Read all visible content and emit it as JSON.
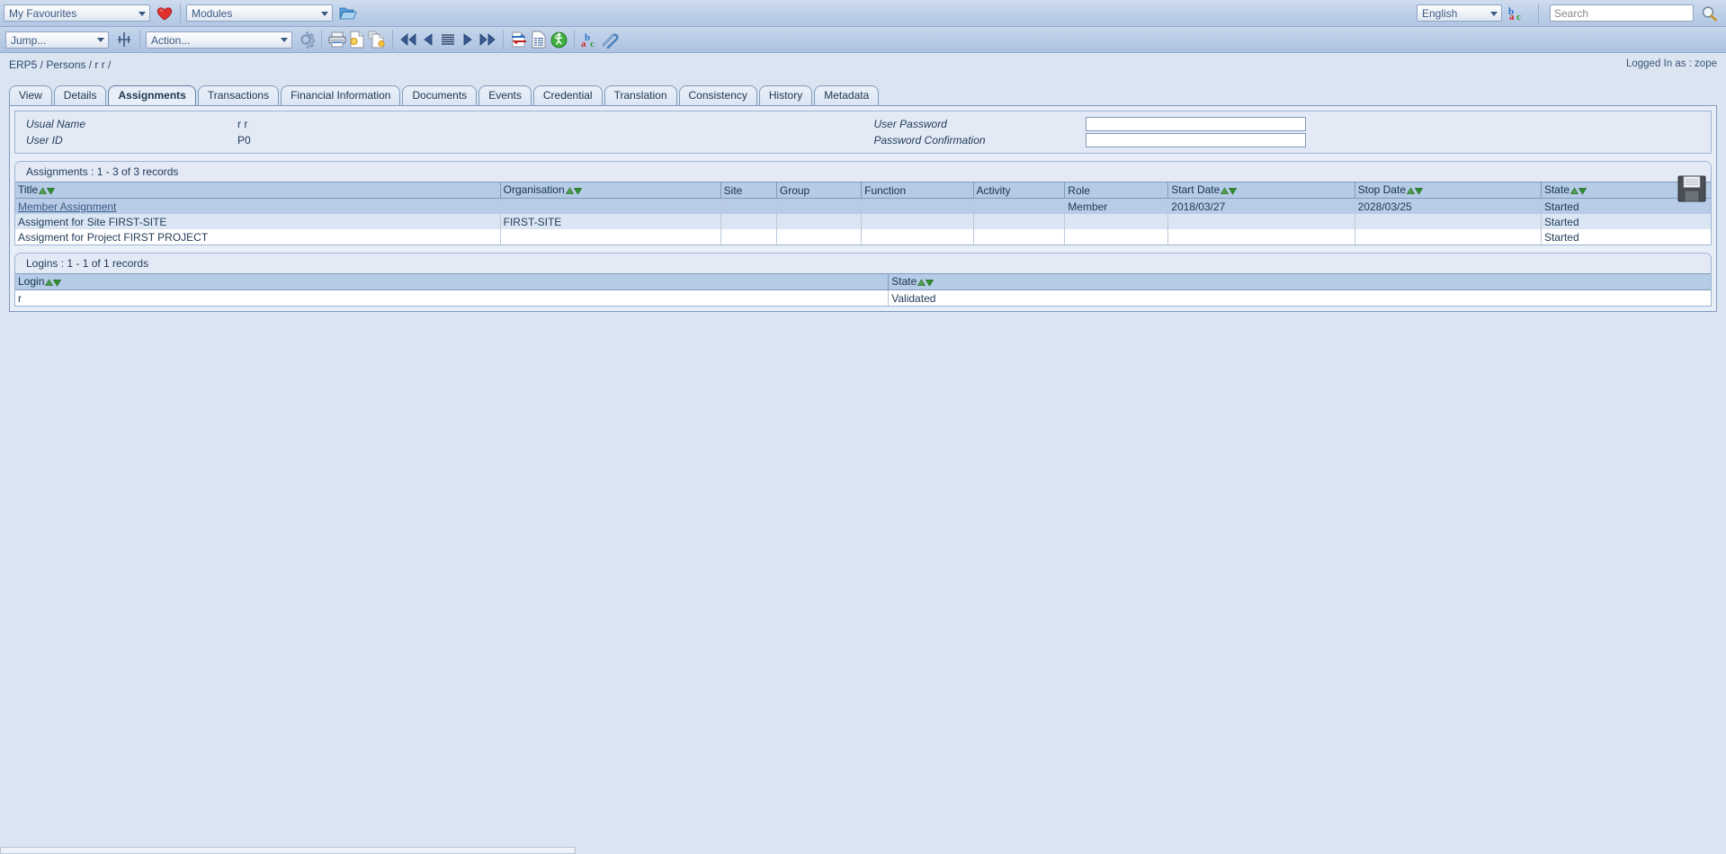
{
  "topbar": {
    "favourites_label": "My Favourites",
    "modules_label": "Modules",
    "language_label": "English",
    "search_placeholder": "Search",
    "search_value": "",
    "icons": [
      "heart-icon",
      "open-folder-icon",
      "translate-icon",
      "search-icon"
    ]
  },
  "actionbar": {
    "jump_label": "Jump...",
    "action_label": "Action...",
    "icons": [
      "jump-target-icon",
      "gear-icon",
      "print-icon",
      "new-document-icon",
      "copy-document-icon",
      "first-page-icon",
      "previous-page-icon",
      "list-icon",
      "next-page-icon",
      "last-page-icon",
      "exchange-icon",
      "report-icon",
      "run-icon",
      "translate-icon",
      "clip-icon"
    ]
  },
  "breadcrumb": "ERP5 / Persons / r r /",
  "logged_in": "Logged In as : zope",
  "tabs": [
    {
      "label": "View",
      "active": false
    },
    {
      "label": "Details",
      "active": false
    },
    {
      "label": "Assignments",
      "active": true
    },
    {
      "label": "Transactions",
      "active": false
    },
    {
      "label": "Financial Information",
      "active": false
    },
    {
      "label": "Documents",
      "active": false
    },
    {
      "label": "Events",
      "active": false
    },
    {
      "label": "Credential",
      "active": false
    },
    {
      "label": "Translation",
      "active": false
    },
    {
      "label": "Consistency",
      "active": false
    },
    {
      "label": "History",
      "active": false
    },
    {
      "label": "Metadata",
      "active": false
    }
  ],
  "form": {
    "usual_name_label": "Usual Name",
    "usual_name_value": "r r",
    "user_id_label": "User ID",
    "user_id_value": "P0",
    "user_password_label": "User Password",
    "user_password_value": "",
    "password_confirmation_label": "Password Confirmation",
    "password_confirmation_value": ""
  },
  "assignments": {
    "title": "Assignments : 1 - 3 of 3 records",
    "columns": [
      "Title",
      "Organisation",
      "Site",
      "Group",
      "Function",
      "Activity",
      "Role",
      "Start Date",
      "Stop Date",
      "State"
    ],
    "sortable": [
      true,
      true,
      false,
      false,
      false,
      false,
      false,
      true,
      true,
      true
    ],
    "rows": [
      {
        "style": "r-sel",
        "link": true,
        "cells": [
          "Member Assignment",
          "",
          "",
          "",
          "",
          "",
          "Member",
          "2018/03/27",
          "2028/03/25",
          "Started"
        ]
      },
      {
        "style": "r-alt",
        "link": false,
        "cells": [
          "Assigment for Site FIRST-SITE",
          "FIRST-SITE",
          "",
          "",
          "",
          "",
          "",
          "",
          "",
          "Started"
        ]
      },
      {
        "style": "r-odd",
        "link": false,
        "cells": [
          "Assigment for Project FIRST PROJECT",
          "",
          "",
          "",
          "",
          "",
          "",
          "",
          "",
          "Started"
        ]
      }
    ]
  },
  "logins": {
    "title": "Logins : 1 - 1 of 1 records",
    "columns": [
      "Login",
      "State"
    ],
    "sortable": [
      true,
      true
    ],
    "rows": [
      {
        "style": "r-odd",
        "link": false,
        "cells": [
          "r",
          "Validated"
        ]
      }
    ]
  },
  "save": {
    "icon": "floppy-save-icon"
  },
  "colors": {
    "page_bg": "#dbe5f1",
    "topbar": "#bed0e8",
    "panel_bg": "#e8eef8",
    "header_cell": "#b6cbe6",
    "selected_row": "#b8cce7",
    "accent_text": "#1f3a57",
    "sort_green": "#3f8f3f"
  }
}
